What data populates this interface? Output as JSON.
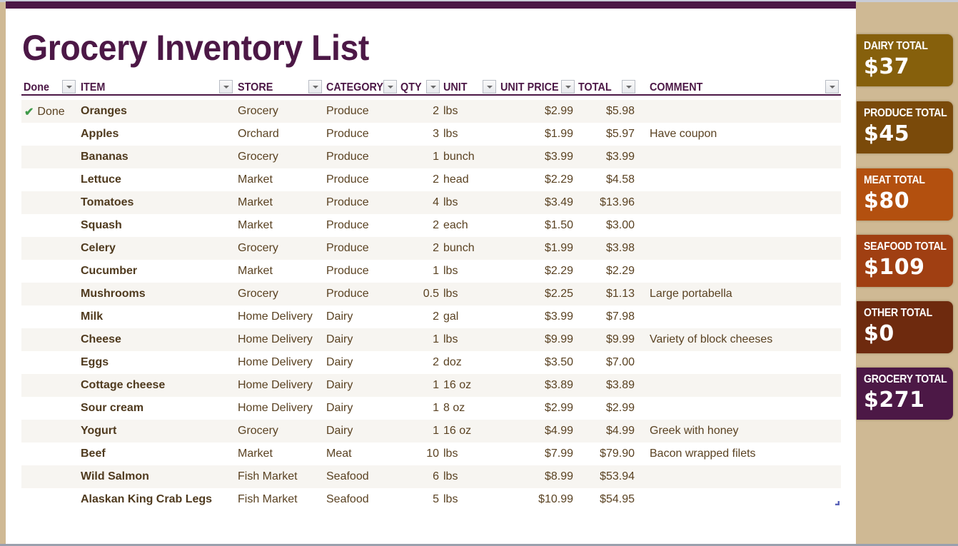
{
  "title": "Grocery Inventory List",
  "columns": [
    {
      "key": "done",
      "label": "Done"
    },
    {
      "key": "item",
      "label": "ITEM"
    },
    {
      "key": "store",
      "label": "STORE"
    },
    {
      "key": "category",
      "label": "CATEGORY"
    },
    {
      "key": "qty",
      "label": "QTY"
    },
    {
      "key": "unit",
      "label": "UNIT"
    },
    {
      "key": "unit_price",
      "label": "UNIT PRICE"
    },
    {
      "key": "total",
      "label": "TOTAL"
    },
    {
      "key": "comment",
      "label": "COMMENT"
    }
  ],
  "rows": [
    {
      "done": "Done",
      "done_icon": "checkmark-icon",
      "item": "Oranges",
      "store": "Grocery",
      "category": "Produce",
      "qty": "2",
      "unit": "lbs",
      "unit_price": "$2.99",
      "total": "$5.98",
      "comment": ""
    },
    {
      "done": "",
      "item": "Apples",
      "store": "Orchard",
      "category": "Produce",
      "qty": "3",
      "unit": "lbs",
      "unit_price": "$1.99",
      "total": "$5.97",
      "comment": "Have coupon"
    },
    {
      "done": "",
      "item": "Bananas",
      "store": "Grocery",
      "category": "Produce",
      "qty": "1",
      "unit": "bunch",
      "unit_price": "$3.99",
      "total": "$3.99",
      "comment": ""
    },
    {
      "done": "",
      "item": "Lettuce",
      "store": "Market",
      "category": "Produce",
      "qty": "2",
      "unit": "head",
      "unit_price": "$2.29",
      "total": "$4.58",
      "comment": ""
    },
    {
      "done": "",
      "item": "Tomatoes",
      "store": "Market",
      "category": "Produce",
      "qty": "4",
      "unit": "lbs",
      "unit_price": "$3.49",
      "total": "$13.96",
      "comment": ""
    },
    {
      "done": "",
      "item": "Squash",
      "store": "Market",
      "category": "Produce",
      "qty": "2",
      "unit": "each",
      "unit_price": "$1.50",
      "total": "$3.00",
      "comment": ""
    },
    {
      "done": "",
      "item": "Celery",
      "store": "Grocery",
      "category": "Produce",
      "qty": "2",
      "unit": "bunch",
      "unit_price": "$1.99",
      "total": "$3.98",
      "comment": ""
    },
    {
      "done": "",
      "item": "Cucumber",
      "store": "Market",
      "category": "Produce",
      "qty": "1",
      "unit": "lbs",
      "unit_price": "$2.29",
      "total": "$2.29",
      "comment": ""
    },
    {
      "done": "",
      "item": "Mushrooms",
      "store": "Grocery",
      "category": "Produce",
      "qty": "0.5",
      "unit": "lbs",
      "unit_price": "$2.25",
      "total": "$1.13",
      "comment": "Large portabella"
    },
    {
      "done": "",
      "item": "Milk",
      "store": "Home Delivery",
      "category": "Dairy",
      "qty": "2",
      "unit": "gal",
      "unit_price": "$3.99",
      "total": "$7.98",
      "comment": ""
    },
    {
      "done": "",
      "item": "Cheese",
      "store": "Home Delivery",
      "category": "Dairy",
      "qty": "1",
      "unit": "lbs",
      "unit_price": "$9.99",
      "total": "$9.99",
      "comment": "Variety of block cheeses"
    },
    {
      "done": "",
      "item": "Eggs",
      "store": "Home Delivery",
      "category": "Dairy",
      "qty": "2",
      "unit": "doz",
      "unit_price": "$3.50",
      "total": "$7.00",
      "comment": ""
    },
    {
      "done": "",
      "item": "Cottage cheese",
      "store": "Home Delivery",
      "category": "Dairy",
      "qty": "1",
      "unit": "16 oz",
      "unit_price": "$3.89",
      "total": "$3.89",
      "comment": ""
    },
    {
      "done": "",
      "item": "Sour cream",
      "store": "Home Delivery",
      "category": "Dairy",
      "qty": "1",
      "unit": "8 oz",
      "unit_price": "$2.99",
      "total": "$2.99",
      "comment": ""
    },
    {
      "done": "",
      "item": "Yogurt",
      "store": "Grocery",
      "category": "Dairy",
      "qty": "1",
      "unit": "16 oz",
      "unit_price": "$4.99",
      "total": "$4.99",
      "comment": "Greek with honey"
    },
    {
      "done": "",
      "item": "Beef",
      "store": "Market",
      "category": "Meat",
      "qty": "10",
      "unit": "lbs",
      "unit_price": "$7.99",
      "total": "$79.90",
      "comment": "Bacon wrapped filets"
    },
    {
      "done": "",
      "item": "Wild Salmon",
      "store": "Fish Market",
      "category": "Seafood",
      "qty": "6",
      "unit": "lbs",
      "unit_price": "$8.99",
      "total": "$53.94",
      "comment": ""
    },
    {
      "done": "",
      "item": "Alaskan King Crab Legs",
      "store": "Fish Market",
      "category": "Seafood",
      "qty": "5",
      "unit": "lbs",
      "unit_price": "$10.99",
      "total": "$54.95",
      "comment": ""
    }
  ],
  "totals": [
    {
      "label": "DAIRY TOTAL",
      "value": "$37",
      "color": "#86600c"
    },
    {
      "label": "PRODUCE TOTAL",
      "value": "$45",
      "color": "#7a4a0a"
    },
    {
      "label": "MEAT TOTAL",
      "value": "$80",
      "color": "#b3500f"
    },
    {
      "label": "SEAFOOD TOTAL",
      "value": "$109",
      "color": "#a03f12"
    },
    {
      "label": "OTHER TOTAL",
      "value": "$0",
      "color": "#6e2a0e"
    },
    {
      "label": "GROCERY TOTAL",
      "value": "$271",
      "color": "#4c1846"
    }
  ],
  "colors": {
    "accent": "#4c1846",
    "background": "#cfb994",
    "row_alt": "#f7f5f1",
    "text": "#5a4222",
    "check": "#3f9a4a"
  }
}
